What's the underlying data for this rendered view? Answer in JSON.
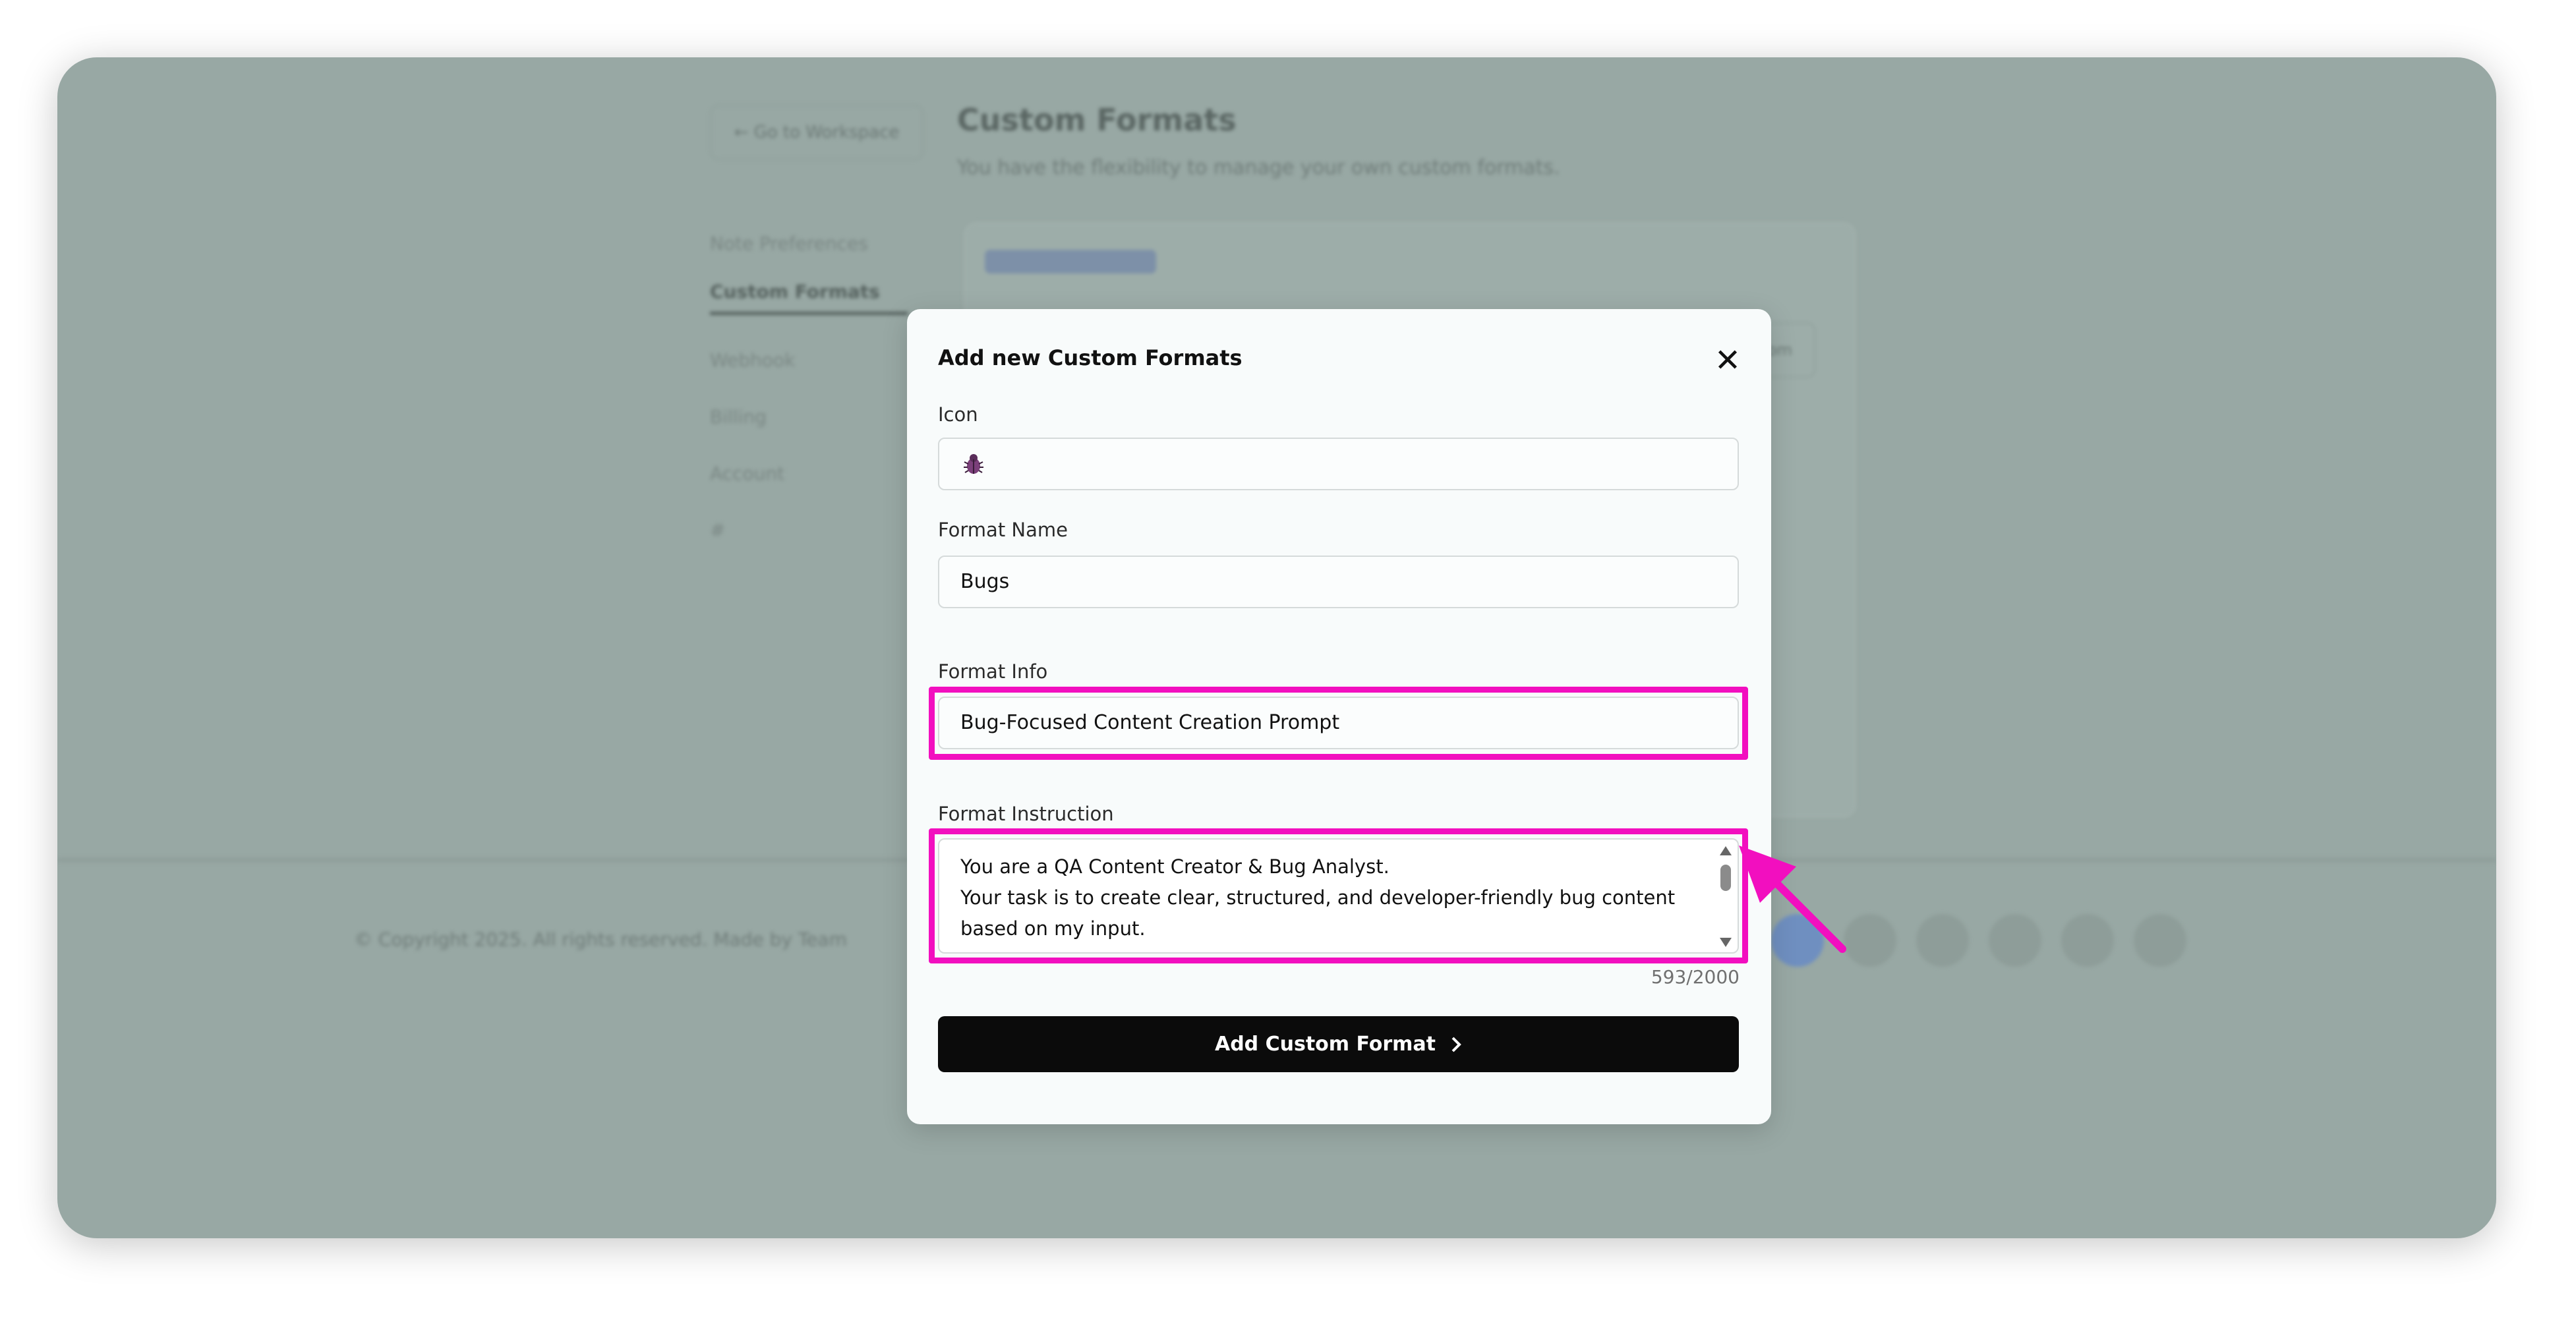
{
  "background": {
    "back_button": "← Go to Workspace",
    "page_title": "Custom Formats",
    "page_subtitle": "You have the flexibility to manage your own custom formats.",
    "nav_items": [
      "Note Preferences",
      "Custom Formats",
      "Webhook",
      "Billing",
      "Account",
      "#"
    ],
    "add_format_button": "+ Add Custom Format",
    "copyright": "© Copyright 2025. All rights reserved. Made by Team"
  },
  "modal": {
    "title": "Add new Custom Formats",
    "close_icon": "close-icon",
    "icon_label": "Icon",
    "icon_value": "bug-icon",
    "format_name_label": "Format Name",
    "format_name_value": "Bugs",
    "format_info_label": "Format Info",
    "format_info_value": "Bug-Focused Content Creation Prompt",
    "format_instruction_label": "Format Instruction",
    "format_instruction_lines": [
      "You are a QA Content Creator & Bug Analyst.",
      "Your task is to create clear, structured, and developer-friendly bug content based on my input."
    ],
    "char_counter": "593/2000",
    "submit_label": "Add Custom Format",
    "submit_icon": "chevron-right-icon"
  },
  "annotation": {
    "highlight_color": "#f20fbf",
    "arrow_color": "#f20fbf"
  }
}
